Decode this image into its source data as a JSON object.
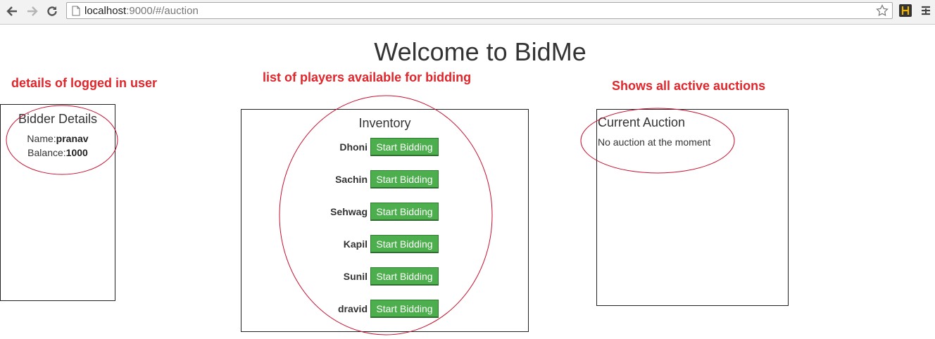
{
  "browser": {
    "url_host": "localhost",
    "url_path": ":9000/#/auction"
  },
  "page": {
    "title": "Welcome to BidMe"
  },
  "annotations": {
    "bidder": "details of logged in user",
    "inventory": "list of players available for bidding",
    "auction": "Shows all active auctions"
  },
  "bidder": {
    "heading": "Bidder Details",
    "name_label": "Name:",
    "name_value": "pranav",
    "balance_label": "Balance:",
    "balance_value": "1000"
  },
  "inventory": {
    "heading": "Inventory",
    "button_label": "Start Bidding",
    "players": [
      {
        "name": "Dhoni"
      },
      {
        "name": "Sachin"
      },
      {
        "name": "Sehwag"
      },
      {
        "name": "Kapil"
      },
      {
        "name": "Sunil"
      },
      {
        "name": "dravid"
      }
    ]
  },
  "auction": {
    "heading": "Current Auction",
    "message": "No auction at the moment"
  },
  "colors": {
    "annotation": "#e0252b",
    "button": "#4cae4c",
    "ellipse": "#c8102e"
  }
}
